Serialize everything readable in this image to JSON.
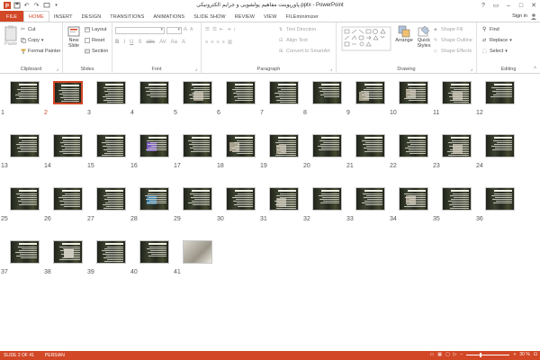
{
  "window": {
    "title": "پاورپوینت مفاهیم پولشویی و جرایم الکترونیکی.pptx - PowerPoint",
    "help": "?",
    "controls": [
      "ribbon-display",
      "minimize",
      "maximize",
      "close"
    ]
  },
  "tabs": [
    {
      "label": "FILE"
    },
    {
      "label": "HOME"
    },
    {
      "label": "INSERT"
    },
    {
      "label": "DESIGN"
    },
    {
      "label": "TRANSITIONS"
    },
    {
      "label": "ANIMATIONS"
    },
    {
      "label": "SLIDE SHOW"
    },
    {
      "label": "REVIEW"
    },
    {
      "label": "VIEW"
    },
    {
      "label": "FILEminimizer"
    }
  ],
  "active_tab": "HOME",
  "signin": "Sign in",
  "ribbon": {
    "clipboard": {
      "label": "Clipboard",
      "paste": "Paste",
      "cut": "Cut",
      "copy": "Copy",
      "format_painter": "Format Painter"
    },
    "slides": {
      "label": "Slides",
      "new_slide_line1": "New",
      "new_slide_line2": "Slide",
      "layout": "Layout",
      "reset": "Reset",
      "section": "Section"
    },
    "font": {
      "label": "Font"
    },
    "paragraph": {
      "label": "Paragraph",
      "text_direction": "Text Direction",
      "align_text": "Align Text",
      "convert_smartart": "Convert to SmartArt"
    },
    "drawing": {
      "label": "Drawing",
      "arrange": "Arrange",
      "quick_styles_line1": "Quick",
      "quick_styles_line2": "Styles",
      "shape_fill": "Shape Fill",
      "shape_outline": "Shape Outline",
      "shape_effects": "Shape Effects"
    },
    "editing": {
      "label": "Editing",
      "find": "Find",
      "replace": "Replace",
      "select": "Select"
    }
  },
  "slides": {
    "count": 41,
    "selected": 2,
    "numbers": [
      "1",
      "2",
      "3",
      "4",
      "5",
      "6",
      "7",
      "8",
      "9",
      "10",
      "11",
      "12",
      "13",
      "14",
      "15",
      "16",
      "17",
      "18",
      "19",
      "20",
      "21",
      "22",
      "23",
      "24",
      "25",
      "26",
      "27",
      "28",
      "29",
      "30",
      "31",
      "32",
      "33",
      "34",
      "35",
      "36",
      "37",
      "38",
      "39",
      "40",
      "41"
    ],
    "with_picture": [
      5,
      9,
      10,
      11,
      16,
      18,
      19,
      23,
      28,
      31,
      34,
      38,
      41
    ]
  },
  "status": {
    "slide_info": "SLIDE 2 OF 41",
    "language": "PERSIAN",
    "zoom": "30 %",
    "zoom_level": 0.3
  },
  "colors": {
    "accent": "#d24726",
    "slide_bg": "#2a2e22"
  }
}
